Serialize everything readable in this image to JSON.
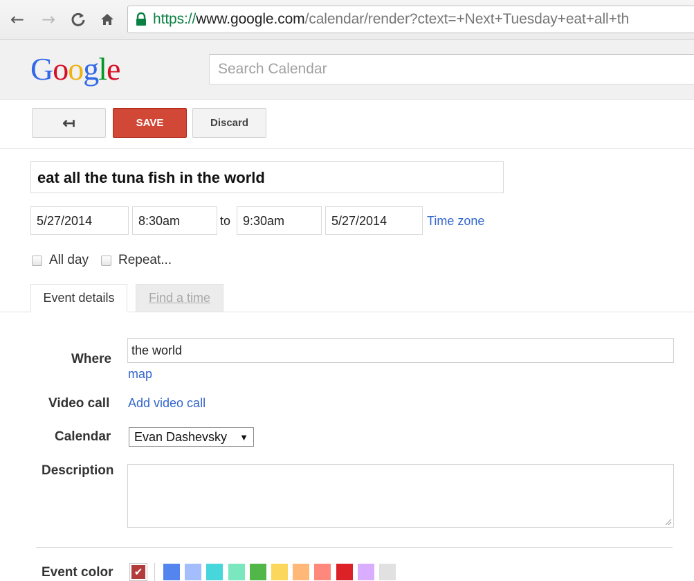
{
  "browser": {
    "url_scheme": "https://",
    "url_host": "www.google.com",
    "url_path": "/calendar/render?ctext=+Next+Tuesday+eat+all+th",
    "back_icon": "arrow-left-icon",
    "forward_icon": "arrow-right-icon",
    "reload_icon": "reload-icon",
    "home_icon": "home-icon",
    "lock_icon": "lock-icon"
  },
  "header": {
    "logo_letters": [
      {
        "ch": "G",
        "color": "#3369e8"
      },
      {
        "ch": "o",
        "color": "#d50f25"
      },
      {
        "ch": "o",
        "color": "#eeb211"
      },
      {
        "ch": "g",
        "color": "#3369e8"
      },
      {
        "ch": "l",
        "color": "#009925"
      },
      {
        "ch": "e",
        "color": "#d50f25"
      }
    ],
    "search_placeholder": "Search Calendar"
  },
  "toolbar": {
    "back_glyph": "↤",
    "save_label": "SAVE",
    "discard_label": "Discard"
  },
  "event": {
    "title": "eat all the tuna fish in the world",
    "start_date": "5/27/2014",
    "start_time": "8:30am",
    "to_label": "to",
    "end_time": "9:30am",
    "end_date": "5/27/2014",
    "timezone_link": "Time zone",
    "all_day_label": "All day",
    "repeat_label": "Repeat..."
  },
  "tabs": {
    "event_details": "Event details",
    "find_a_time": "Find a time"
  },
  "details": {
    "where_label": "Where",
    "where_value": "the world",
    "map_link": "map",
    "video_label": "Video call",
    "video_link": "Add video call",
    "calendar_label": "Calendar",
    "calendar_value": "Evan Dashevsky",
    "calendar_arrow": "▼",
    "description_label": "Description",
    "description_value": "",
    "event_color_label": "Event color",
    "selected_color": "#b23c3c",
    "check_glyph": "✔",
    "colors": [
      "#5484ed",
      "#a4bdfc",
      "#46d6db",
      "#7ae7bf",
      "#51b749",
      "#fbd75b",
      "#ffb878",
      "#ff887c",
      "#dc2127",
      "#dbadff",
      "#e1e1e1"
    ]
  }
}
